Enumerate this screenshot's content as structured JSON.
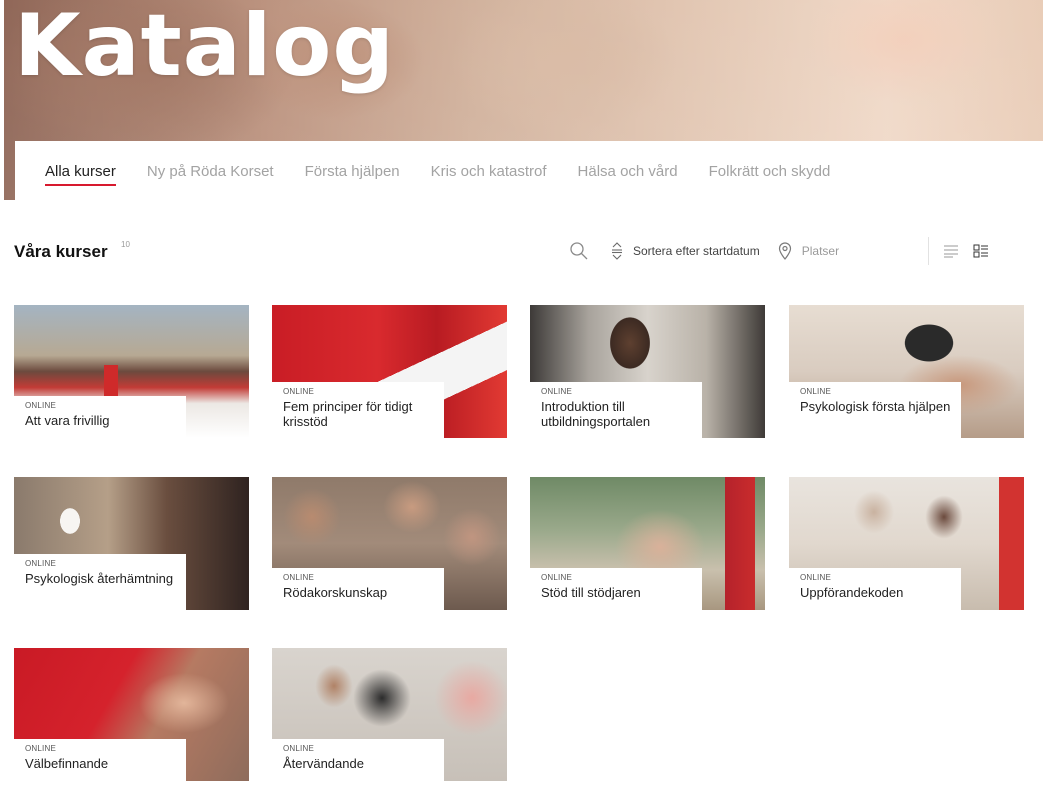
{
  "hero": {
    "title": "Katalog"
  },
  "tabs": [
    {
      "label": "Alla kurser",
      "active": true
    },
    {
      "label": "Ny på Röda Korset",
      "active": false
    },
    {
      "label": "Första hjälpen",
      "active": false
    },
    {
      "label": "Kris och katastrof",
      "active": false
    },
    {
      "label": "Hälsa och vård",
      "active": false
    },
    {
      "label": "Folkrätt och skydd",
      "active": false
    }
  ],
  "section": {
    "title": "Våra kurser",
    "count": "10"
  },
  "toolbar": {
    "search_icon": "search-icon",
    "sort_label": "Sortera efter startdatum",
    "location_placeholder": "Platser",
    "view_icons": [
      "list-view-icon",
      "grid-view-icon"
    ]
  },
  "colors": {
    "accent": "#d7192e",
    "tab_inactive": "#a3a3a3",
    "text": "#222222"
  },
  "courses": [
    {
      "type": "ONLINE",
      "title": "Att vara frivillig"
    },
    {
      "type": "ONLINE",
      "title": "Fem principer för tidigt krisstöd"
    },
    {
      "type": "ONLINE",
      "title": "Introduktion till utbildningsportalen"
    },
    {
      "type": "ONLINE",
      "title": "Psykologisk första hjälpen"
    },
    {
      "type": "ONLINE",
      "title": "Psykologisk återhämtning"
    },
    {
      "type": "ONLINE",
      "title": "Rödakorskunskap"
    },
    {
      "type": "ONLINE",
      "title": "Stöd till stödjaren"
    },
    {
      "type": "ONLINE",
      "title": "Uppförandekoden"
    },
    {
      "type": "ONLINE",
      "title": "Välbefinnande"
    },
    {
      "type": "ONLINE",
      "title": "Återvändande"
    }
  ]
}
